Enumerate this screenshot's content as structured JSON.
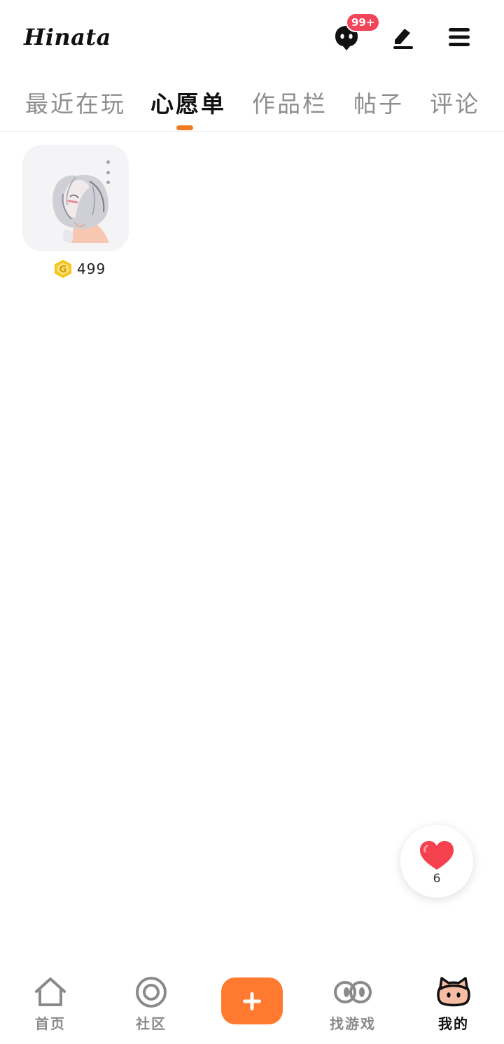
{
  "header": {
    "username": "Hinata",
    "message_badge": "99+"
  },
  "tabs": [
    {
      "label": "最近在玩",
      "active": false
    },
    {
      "label": "心愿单",
      "active": true
    },
    {
      "label": "作品栏",
      "active": false
    },
    {
      "label": "帖子",
      "active": false
    },
    {
      "label": "评论",
      "active": false
    }
  ],
  "wishlist": [
    {
      "thumbnail": "white-haired anime character",
      "price": "499",
      "currency_icon": "gold-coin-icon"
    }
  ],
  "like_fab": {
    "count": "6",
    "icon": "heart-icon"
  },
  "bottom_nav": [
    {
      "label": "首页",
      "icon": "home-icon",
      "active": false
    },
    {
      "label": "社区",
      "icon": "community-icon",
      "active": false
    },
    {
      "label": "",
      "icon": "plus-icon",
      "active": false
    },
    {
      "label": "找游戏",
      "icon": "find-games-icon",
      "active": false
    },
    {
      "label": "我的",
      "icon": "profile-cat-icon",
      "active": true
    }
  ],
  "colors": {
    "accent": "#f07a22",
    "add_button": "#ff7a2e",
    "badge": "#f2455a",
    "tab_inactive": "#8e8e8e",
    "heart": "#f5404e",
    "coin": "#f5c518"
  }
}
